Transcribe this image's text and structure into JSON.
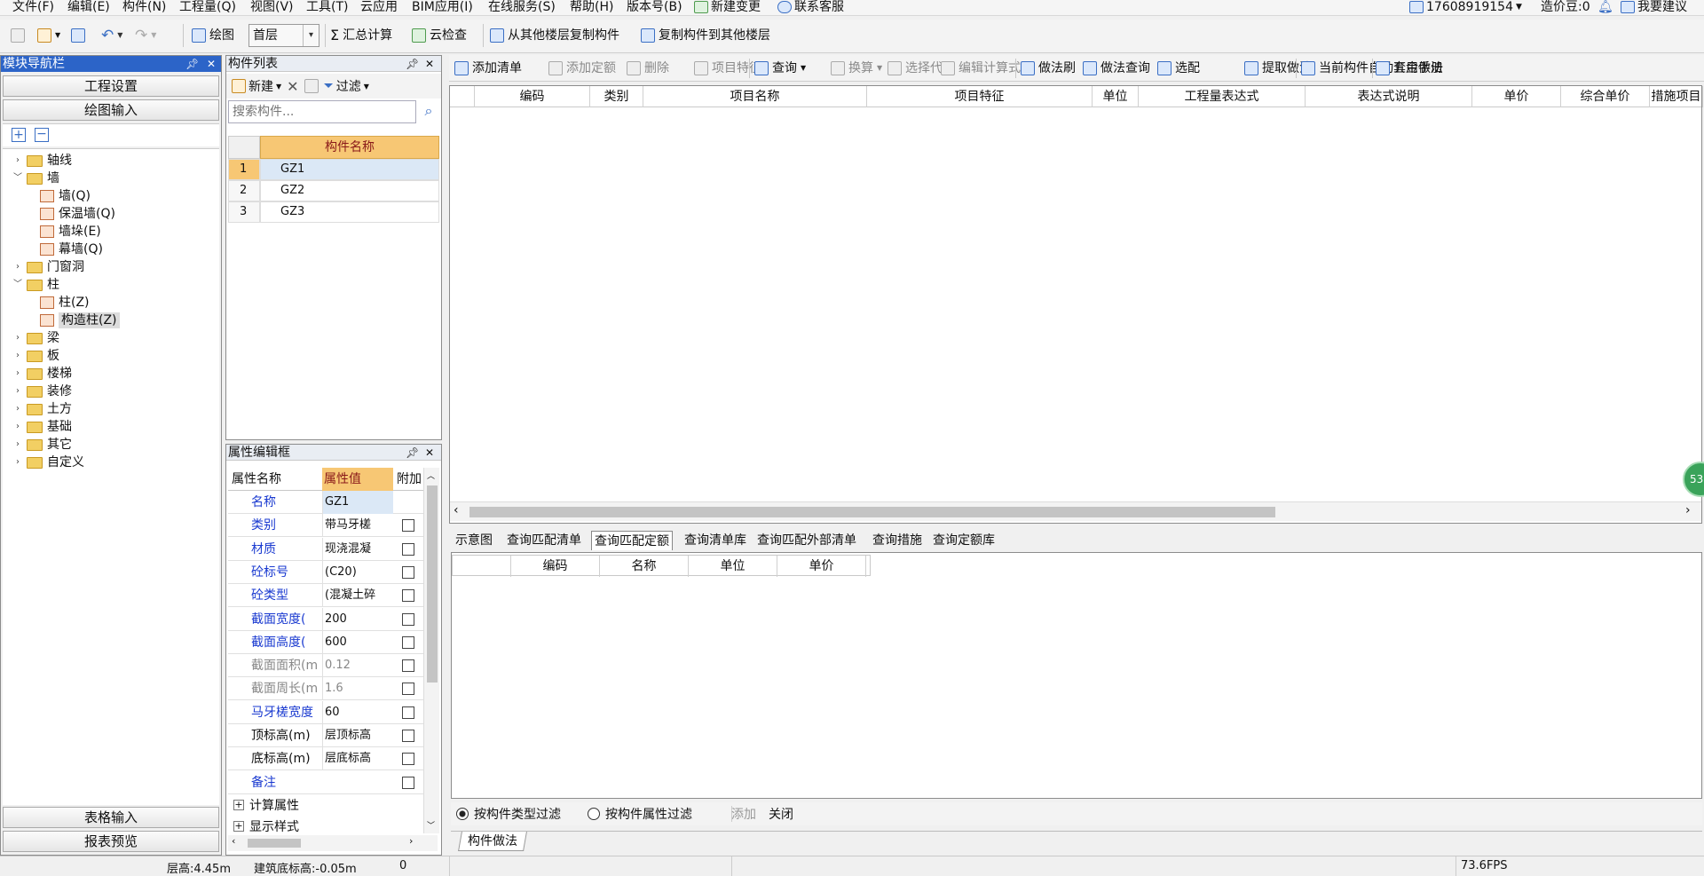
{
  "menu": [
    "文件(F)",
    "编辑(E)",
    "构件(N)",
    "工程量(Q)",
    "视图(V)",
    "工具(T)",
    "云应用",
    "BIM应用(I)",
    "在线服务(S)",
    "帮助(H)",
    "版本号(B)",
    "新建变更",
    "联系客服"
  ],
  "account": {
    "phone": "17608919154",
    "beans": "造价豆:0",
    "suggest": "我要建议"
  },
  "toolbar1": {
    "draw": "绘图",
    "floor": "首层",
    "sum": "汇总计算",
    "cloud_check": "云检查",
    "copy_from": "从其他楼层复制构件",
    "copy_to": "复制构件到其他楼层"
  },
  "nav": {
    "title": "模块导航栏",
    "project_settings": "工程设置",
    "draw_input": "绘图输入",
    "table_input": "表格输入",
    "report_preview": "报表预览",
    "tree": [
      {
        "label": "轴线",
        "level": 0,
        "expanded": false
      },
      {
        "label": "墙",
        "level": 0,
        "expanded": true
      },
      {
        "label": "墙(Q)",
        "level": 1
      },
      {
        "label": "保温墙(Q)",
        "level": 1
      },
      {
        "label": "墙垛(E)",
        "level": 1
      },
      {
        "label": "幕墙(Q)",
        "level": 1
      },
      {
        "label": "门窗洞",
        "level": 0,
        "expanded": false
      },
      {
        "label": "柱",
        "level": 0,
        "expanded": true
      },
      {
        "label": "柱(Z)",
        "level": 1
      },
      {
        "label": "构造柱(Z)",
        "level": 1,
        "selected": true
      },
      {
        "label": "梁",
        "level": 0,
        "expanded": false
      },
      {
        "label": "板",
        "level": 0,
        "expanded": false
      },
      {
        "label": "楼梯",
        "level": 0,
        "expanded": false
      },
      {
        "label": "装修",
        "level": 0,
        "expanded": false
      },
      {
        "label": "土方",
        "level": 0,
        "expanded": false
      },
      {
        "label": "基础",
        "level": 0,
        "expanded": false
      },
      {
        "label": "其它",
        "level": 0,
        "expanded": false
      },
      {
        "label": "自定义",
        "level": 0,
        "expanded": false
      }
    ]
  },
  "complist": {
    "title": "构件列表",
    "new": "新建",
    "filter": "过滤",
    "search_placeholder": "搜索构件...",
    "col_name": "构件名称",
    "rows": [
      {
        "n": "1",
        "name": "GZ1"
      },
      {
        "n": "2",
        "name": "GZ2"
      },
      {
        "n": "3",
        "name": "GZ3"
      }
    ]
  },
  "props": {
    "title": "属性编辑框",
    "h_name": "属性名称",
    "h_value": "属性值",
    "h_extra": "附加",
    "rows": [
      {
        "name": "名称",
        "value": "GZ1",
        "type": "blue",
        "cb": false
      },
      {
        "name": "类别",
        "value": "带马牙槎",
        "type": "blue",
        "cb": true
      },
      {
        "name": "材质",
        "value": "现浇混凝",
        "type": "blue",
        "cb": true
      },
      {
        "name": "砼标号",
        "value": "(C20)",
        "type": "blue",
        "cb": true
      },
      {
        "name": "砼类型",
        "value": "(混凝土碎",
        "type": "blue",
        "cb": true
      },
      {
        "name": "截面宽度(",
        "value": "200",
        "type": "blue",
        "cb": true
      },
      {
        "name": "截面高度(",
        "value": "600",
        "type": "blue",
        "cb": true
      },
      {
        "name": "截面面积(m",
        "value": "0.12",
        "type": "gray",
        "cb": true
      },
      {
        "name": "截面周长(m",
        "value": "1.6",
        "type": "gray",
        "cb": true
      },
      {
        "name": "马牙槎宽度",
        "value": "60",
        "type": "blue",
        "cb": true
      },
      {
        "name": "顶标高(m)",
        "value": "层顶标高",
        "type": "black",
        "cb": true
      },
      {
        "name": "底标高(m)",
        "value": "层底标高",
        "type": "black",
        "cb": true
      },
      {
        "name": "备注",
        "value": "",
        "type": "blue",
        "cb": true
      }
    ],
    "groups": [
      "计算属性",
      "显示样式"
    ]
  },
  "toolbar2": [
    "添加清单",
    "添加定额",
    "删除",
    "项目特征",
    "查询",
    "换算",
    "选择代码",
    "编辑计算式",
    "做法刷",
    "做法查询",
    "选配",
    "提取做法",
    "当前构件自动套用做法",
    "五金手册"
  ],
  "main_cols": [
    "编码",
    "类别",
    "项目名称",
    "项目特征",
    "单位",
    "工程量表达式",
    "表达式说明",
    "单价",
    "综合单价",
    "措施项目"
  ],
  "tabs": [
    "示意图",
    "查询匹配清单",
    "查询匹配定额",
    "查询清单库",
    "查询匹配外部清单",
    "查询措施",
    "查询定额库"
  ],
  "sub_cols": [
    "编码",
    "名称",
    "单位",
    "单价"
  ],
  "filter": {
    "opt1": "按构件类型过滤",
    "opt2": "按构件属性过滤",
    "add": "添加",
    "close": "关闭"
  },
  "bottom_tab": "构件做法",
  "badge": "53",
  "status": {
    "floor_h": "层高:4.45m",
    "base": "建筑底标高:-0.05m",
    "zero": "0",
    "fps": "73.6FPS"
  }
}
